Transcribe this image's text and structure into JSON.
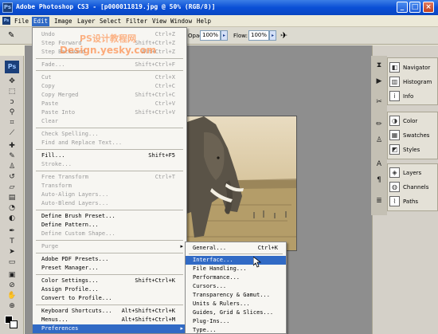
{
  "titlebar": {
    "logo": "Ps",
    "title": "Adobe Photoshop CS3 - [p000011819.jpg @ 50% (RGB/8)]",
    "min": "_",
    "max": "□",
    "close": "×"
  },
  "menubar": {
    "items": [
      "File",
      "Edit",
      "Image",
      "Layer",
      "Select",
      "Filter",
      "View",
      "Window",
      "Help"
    ],
    "active": "Edit"
  },
  "optionsbar": {
    "opacity_label": "Opacity:",
    "opacity_value": "100%",
    "flow_label": "Flow:",
    "flow_value": "100%"
  },
  "tools": {
    "badge": "Ps",
    "icons": [
      "move-icon",
      "marquee-icon",
      "lasso-icon",
      "magic-wand-icon",
      "crop-icon",
      "slice-icon",
      "healing-icon",
      "brush-icon",
      "clone-stamp-icon",
      "history-brush-icon",
      "eraser-icon",
      "gradient-icon",
      "blur-icon",
      "dodge-icon",
      "pen-icon",
      "type-icon",
      "path-select-icon",
      "shape-icon",
      "notes-icon",
      "eyedropper-icon",
      "hand-icon",
      "zoom-icon"
    ]
  },
  "watermark": {
    "line1": "PS设计教程网",
    "line2": "Design.yesky.com"
  },
  "edit_menu": {
    "items": [
      {
        "label": "Undo",
        "shortcut": "Ctrl+Z",
        "disabled": true
      },
      {
        "label": "Step Forward",
        "shortcut": "Shift+Ctrl+Z",
        "disabled": true
      },
      {
        "label": "Step Backward",
        "shortcut": "Alt+Ctrl+Z",
        "disabled": true
      },
      {
        "label": "Fade...",
        "shortcut": "Shift+Ctrl+F",
        "disabled": true
      },
      {
        "label": "Cut",
        "shortcut": "Ctrl+X",
        "disabled": true
      },
      {
        "label": "Copy",
        "shortcut": "Ctrl+C",
        "disabled": true
      },
      {
        "label": "Copy Merged",
        "shortcut": "Shift+Ctrl+C",
        "disabled": true
      },
      {
        "label": "Paste",
        "shortcut": "Ctrl+V",
        "disabled": true
      },
      {
        "label": "Paste Into",
        "shortcut": "Shift+Ctrl+V",
        "disabled": true
      },
      {
        "label": "Clear",
        "shortcut": "",
        "disabled": true
      },
      {
        "label": "Check Spelling...",
        "shortcut": "",
        "disabled": true
      },
      {
        "label": "Find and Replace Text...",
        "shortcut": "",
        "disabled": true
      },
      {
        "label": "Fill...",
        "shortcut": "Shift+F5",
        "disabled": false
      },
      {
        "label": "Stroke...",
        "shortcut": "",
        "disabled": true
      },
      {
        "label": "Free Transform",
        "shortcut": "Ctrl+T",
        "disabled": true
      },
      {
        "label": "Transform",
        "shortcut": "",
        "disabled": true
      },
      {
        "label": "Auto-Align Layers...",
        "shortcut": "",
        "disabled": true
      },
      {
        "label": "Auto-Blend Layers...",
        "shortcut": "",
        "disabled": true
      },
      {
        "label": "Define Brush Preset...",
        "shortcut": "",
        "disabled": false
      },
      {
        "label": "Define Pattern...",
        "shortcut": "",
        "disabled": false
      },
      {
        "label": "Define Custom Shape...",
        "shortcut": "",
        "disabled": true
      },
      {
        "label": "Purge",
        "shortcut": "",
        "disabled": true,
        "submenu": true
      },
      {
        "label": "Adobe PDF Presets...",
        "shortcut": "",
        "disabled": false
      },
      {
        "label": "Preset Manager...",
        "shortcut": "",
        "disabled": false
      },
      {
        "label": "Color Settings...",
        "shortcut": "Shift+Ctrl+K",
        "disabled": false
      },
      {
        "label": "Assign Profile...",
        "shortcut": "",
        "disabled": false
      },
      {
        "label": "Convert to Profile...",
        "shortcut": "",
        "disabled": false
      },
      {
        "label": "Keyboard Shortcuts...",
        "shortcut": "Alt+Shift+Ctrl+K",
        "disabled": false
      },
      {
        "label": "Menus...",
        "shortcut": "Alt+Shift+Ctrl+M",
        "disabled": false
      },
      {
        "label": "Preferences",
        "shortcut": "",
        "disabled": false,
        "submenu": true,
        "highlighted": true
      }
    ]
  },
  "preferences_submenu": {
    "items": [
      {
        "label": "General...",
        "shortcut": "Ctrl+K"
      },
      {
        "label": "Interface...",
        "shortcut": "",
        "highlighted": true
      },
      {
        "label": "File Handling...",
        "shortcut": ""
      },
      {
        "label": "Performance...",
        "shortcut": ""
      },
      {
        "label": "Cursors...",
        "shortcut": ""
      },
      {
        "label": "Transparency & Gamut...",
        "shortcut": ""
      },
      {
        "label": "Units & Rulers...",
        "shortcut": ""
      },
      {
        "label": "Guides, Grid & Slices...",
        "shortcut": ""
      },
      {
        "label": "Plug-Ins...",
        "shortcut": ""
      },
      {
        "label": "Type...",
        "shortcut": ""
      }
    ]
  },
  "panels": {
    "group1": [
      "Navigator",
      "Histogram",
      "Info"
    ],
    "group2": [
      "Color",
      "Swatches",
      "Styles"
    ],
    "group3": [
      "Layers",
      "Channels",
      "Paths"
    ]
  },
  "colors": {
    "title_bar": "#0a4fd6",
    "menu_highlight": "#316ac5",
    "workspace": "#8e8e8e"
  }
}
